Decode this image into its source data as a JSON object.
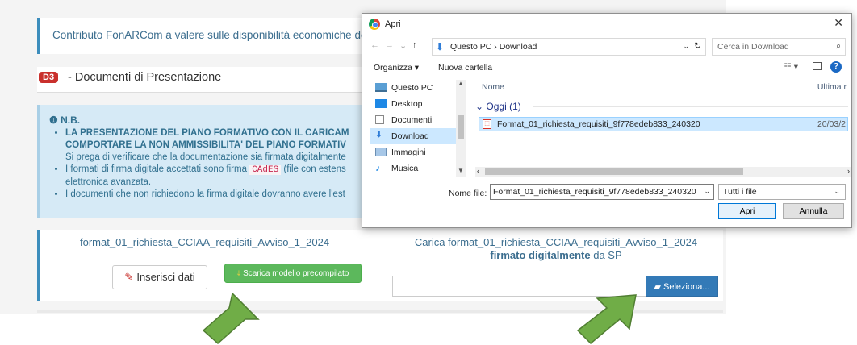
{
  "page": {
    "contribution_text": "Contributo FonARCom a valere sulle disponibilitá economiche de",
    "section": {
      "badge": "D3",
      "title": "- Documenti di Presentazione"
    },
    "note": {
      "heading": "N.B.",
      "item1_bold_line1": "LA PRESENTAZIONE DEL PIANO FORMATIVO CON IL CARICAM",
      "item1_bold_line2": "COMPORTARE LA NON AMMISSIBILITA' DEL PIANO FORMATIV",
      "item1_sub": "Si prega di verificare che la documentazione sia firmata digitalmente",
      "item2_pre": "I formati di firma digitale accettati sono firma",
      "item2_code": "CAdES",
      "item2_post": "(file con estens",
      "item2_cont": "elettronica avanzata.",
      "item3": "I documenti che non richiedono la firma digitale dovranno avere l'est"
    },
    "upload": {
      "file_name": "format_01_richiesta_CCIAA_requisiti_Avviso_1_2024",
      "insert_label": "Inserisci dati",
      "download_label": "Scarica modello precompilato",
      "carica_line1": "Carica format_01_richiesta_CCIAA_requisiti_Avviso_1_2024",
      "carica_bold": "firmato digitalmente",
      "carica_suffix": " da SP",
      "select_label": "Seleziona..."
    }
  },
  "dialog": {
    "title": "Apri",
    "path": "Questo PC  ›  Download",
    "search_placeholder": "Cerca in Download",
    "toolbar": {
      "organize": "Organizza ▾",
      "new_folder": "Nuova cartella"
    },
    "nav_items": [
      {
        "label": "Questo PC",
        "icon": "computer-icon"
      },
      {
        "label": "Desktop",
        "icon": "desktop-icon"
      },
      {
        "label": "Documenti",
        "icon": "documents-icon"
      },
      {
        "label": "Download",
        "icon": "download-icon",
        "selected": true
      },
      {
        "label": "Immagini",
        "icon": "images-icon"
      },
      {
        "label": "Musica",
        "icon": "music-icon"
      }
    ],
    "columns": {
      "name": "Nome",
      "date": "Ultima r"
    },
    "group": "Oggi (1)",
    "file": {
      "name": "Format_01_richiesta_requisiti_9f778edeb833_240320",
      "date": "20/03/2"
    },
    "file_name_label": "Nome file:",
    "file_name_value": "Format_01_richiesta_requisiti_9f778edeb833_240320",
    "file_type": "Tutti i file",
    "open_label": "Apri",
    "cancel_label": "Annulla"
  },
  "colors": {
    "accent": "#3c8dbc",
    "arrow": "#70ad47",
    "danger": "#c9302c",
    "success": "#5cb85c",
    "primary": "#337ab7"
  }
}
